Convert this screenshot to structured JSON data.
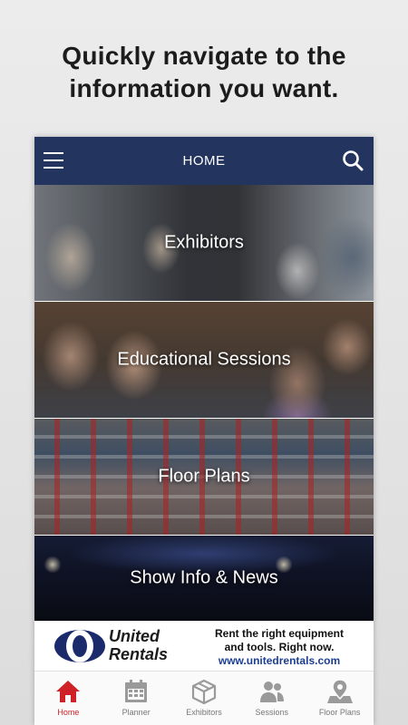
{
  "headline": {
    "line1": "Quickly navigate to the",
    "line2": "information you want."
  },
  "appbar": {
    "title": "HOME",
    "menu_icon": "hamburger-menu-icon",
    "search_icon": "search-icon"
  },
  "tiles": [
    {
      "label": "Exhibitors"
    },
    {
      "label": "Educational Sessions"
    },
    {
      "label": "Floor Plans"
    },
    {
      "label": "Show Info & News"
    }
  ],
  "ad": {
    "brand_line1": "United",
    "brand_line2": "Rentals",
    "tagline1": "Rent the right equipment",
    "tagline2": "and tools. Right now.",
    "url": "www.unitedrentals.com"
  },
  "tabbar": {
    "items": [
      {
        "label": "Home",
        "icon": "home-icon",
        "active": true
      },
      {
        "label": "Planner",
        "icon": "calendar-icon",
        "active": false
      },
      {
        "label": "Exhibitors",
        "icon": "box-icon",
        "active": false
      },
      {
        "label": "Sessions",
        "icon": "people-icon",
        "active": false
      },
      {
        "label": "Floor Plans",
        "icon": "map-pin-icon",
        "active": false
      }
    ]
  },
  "colors": {
    "appbar": "#23355f",
    "active_tab": "#cf2128",
    "inactive_tab": "#9a9a9a",
    "ad_brand_blue": "#1b2a6b"
  }
}
